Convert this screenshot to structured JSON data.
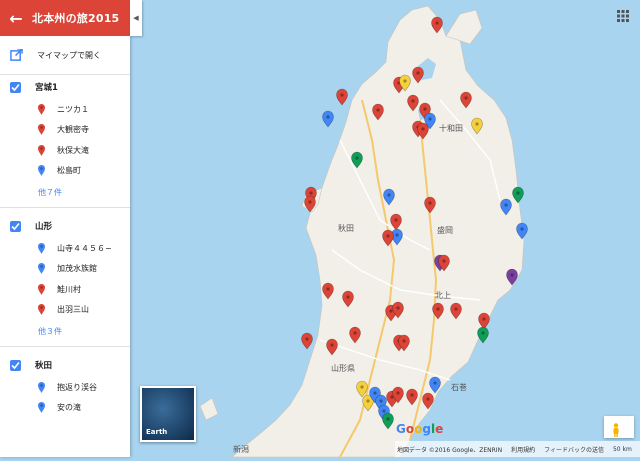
{
  "header": {
    "title": "北本州の旅2015",
    "back_icon": "arrow-left-icon",
    "color": "#db4437"
  },
  "sidebar": {
    "open_in_mymaps": "マイマップで開く",
    "layers": [
      {
        "name": "宮城1",
        "checked": true,
        "items": [
          {
            "label": "ニツカ１",
            "pin_color": "#db4437"
          },
          {
            "label": "大観密寺",
            "pin_color": "#db4437"
          },
          {
            "label": "秋保大滝",
            "pin_color": "#db4437"
          },
          {
            "label": "松島町",
            "pin_color": "#4285f4"
          }
        ],
        "more": "他７件"
      },
      {
        "name": "山形",
        "checked": true,
        "items": [
          {
            "label": "山寺４４５６−",
            "pin_color": "#4285f4"
          },
          {
            "label": "加茂水族館",
            "pin_color": "#4285f4"
          },
          {
            "label": "鮭川村",
            "pin_color": "#db4437"
          },
          {
            "label": "出羽三山",
            "pin_color": "#db4437"
          }
        ],
        "more": "他３件"
      },
      {
        "name": "秋田",
        "checked": true,
        "items": [
          {
            "label": "抱返り渓谷",
            "pin_color": "#4285f4"
          },
          {
            "label": "安の滝",
            "pin_color": "#4285f4"
          }
        ]
      }
    ]
  },
  "map": {
    "place_labels": {
      "towada": "十和田",
      "akita": "秋田",
      "morioka": "盛岡",
      "kitakami": "北上",
      "yamagata_ken": "山形県",
      "ishinomaki": "石巻",
      "niigata": "新潟"
    },
    "earth_label": "Earth",
    "google_logo": "Google",
    "footer": {
      "attribution": "地図データ ©2016 Google、ZENRIN",
      "terms": "利用規約",
      "feedback": "フィードバックの送信",
      "scale": "50 km"
    },
    "pin_colors": {
      "red": "#db4437",
      "blue": "#4285f4",
      "yellow": "#f4d03f",
      "green": "#0f9d58",
      "purple": "#7b3fa0"
    },
    "land_color": "#f2efe9",
    "sea_color": "#a8d4f0"
  }
}
